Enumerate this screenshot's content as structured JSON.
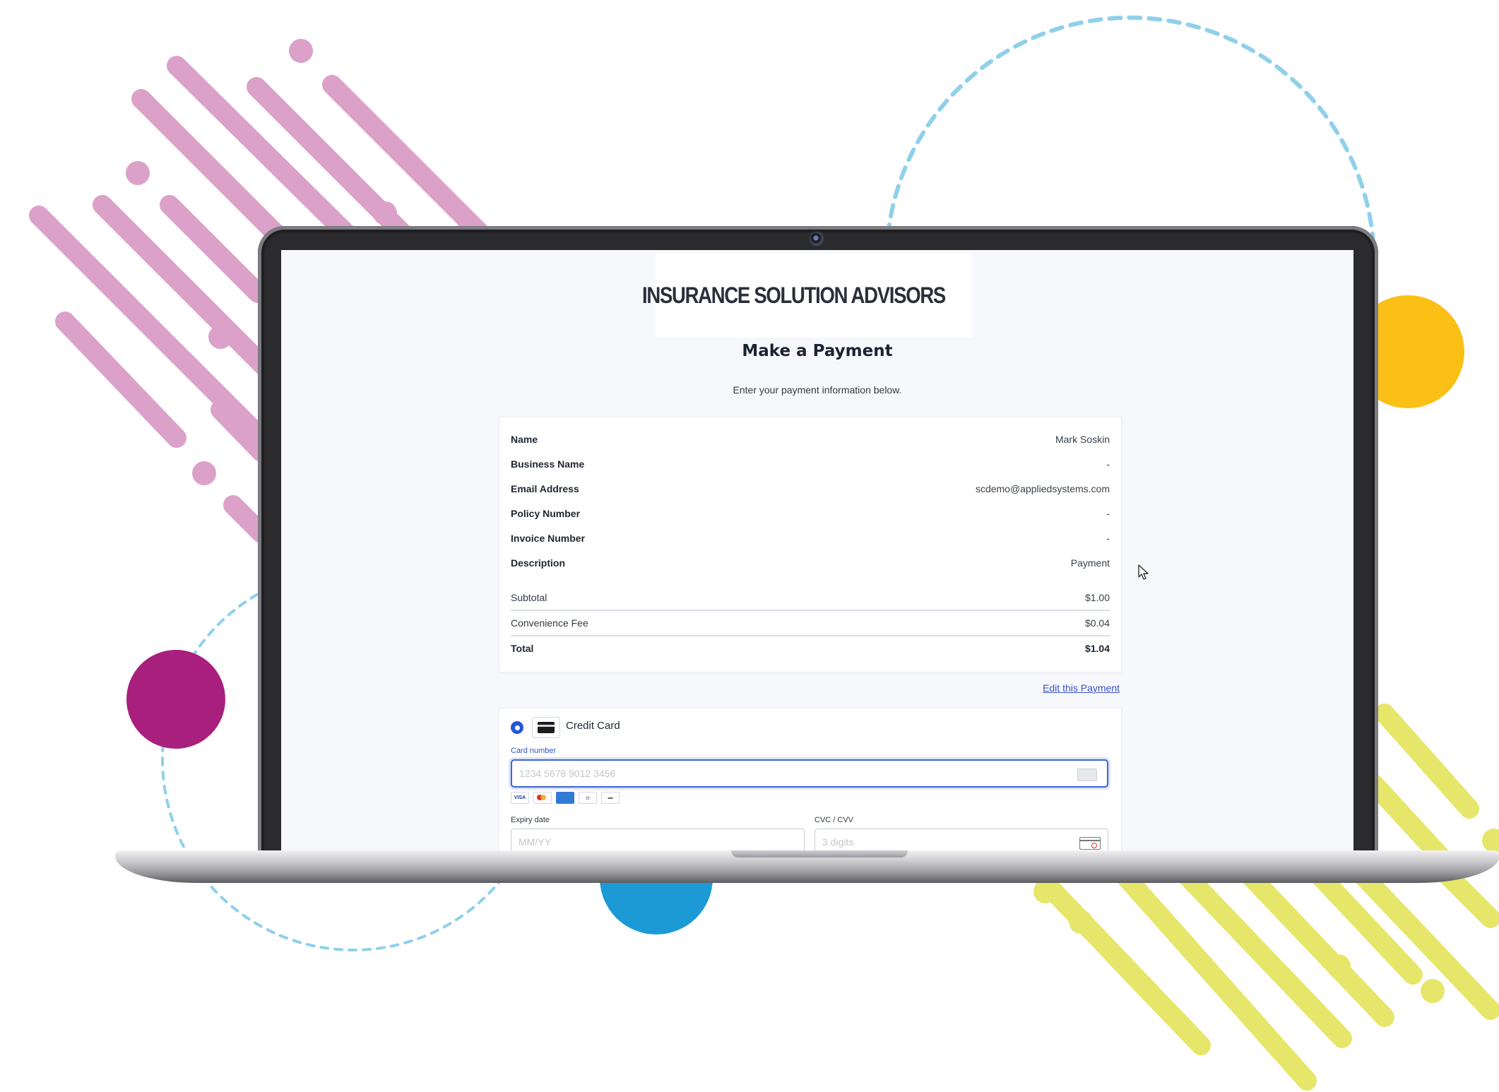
{
  "colors": {
    "pink": "#dba1c9",
    "magenta": "#a81f7d",
    "yellow_circle": "#fbbf16",
    "blue_circle": "#1b9ad6",
    "dashed_circle": "#8fd0ea",
    "lime": "#e6e66a",
    "accent_blue": "#2457d8",
    "link_blue": "#3b51c9"
  },
  "brand": {
    "name": "INSURANCE SOLUTION ADVISORS",
    "logo_icon": "paper-plane-swoosh-icon"
  },
  "page": {
    "title": "Make a Payment",
    "subtitle": "Enter your payment information below."
  },
  "summary": {
    "details": [
      {
        "label": "Name",
        "value": "Mark Soskin"
      },
      {
        "label": "Business Name",
        "value": "-"
      },
      {
        "label": "Email Address",
        "value": "scdemo@appliedsystems.com"
      },
      {
        "label": "Policy Number",
        "value": "-"
      },
      {
        "label": "Invoice Number",
        "value": "-"
      },
      {
        "label": "Description",
        "value": "Payment"
      }
    ],
    "subtotal": {
      "label": "Subtotal",
      "value": "$1.00"
    },
    "fee": {
      "label": "Convenience Fee",
      "value": "$0.04"
    },
    "total": {
      "label": "Total",
      "value": "$1.04"
    }
  },
  "edit_link": "Edit this Payment",
  "payment": {
    "method_label": "Credit Card",
    "method_icon": "credit-card-icon",
    "card_number": {
      "label": "Card number",
      "placeholder": "1234 5678 9012 3456",
      "value": ""
    },
    "card_brands": [
      "VISA",
      "mastercard",
      "amex",
      "diners",
      "discover"
    ],
    "expiry": {
      "label": "Expiry date",
      "placeholder": "MM/YY",
      "value": ""
    },
    "cvc": {
      "label": "CVC / CVV",
      "placeholder": "3 digits",
      "value": ""
    }
  }
}
